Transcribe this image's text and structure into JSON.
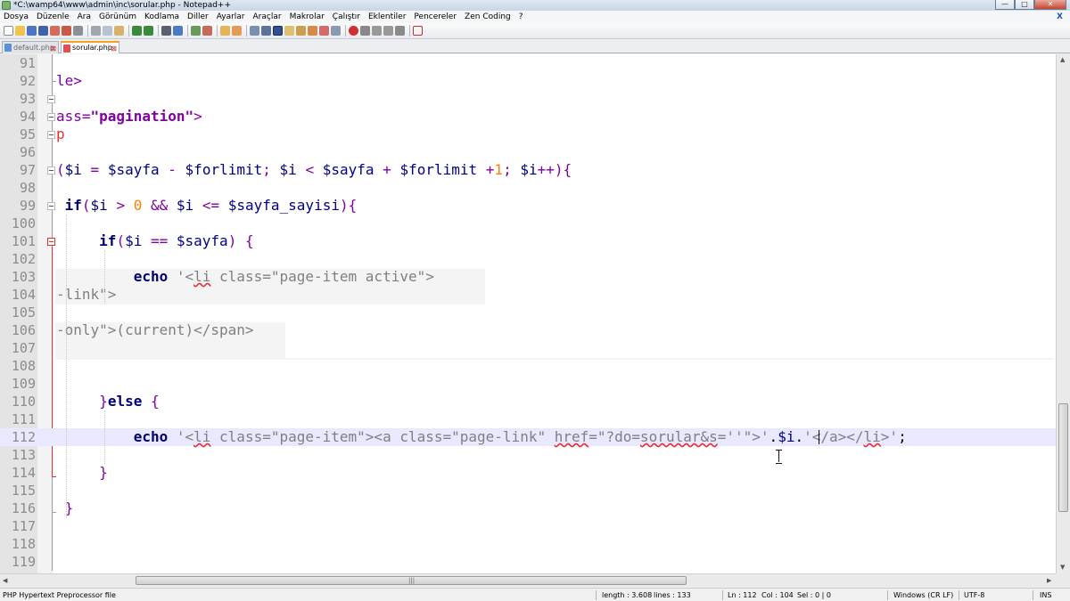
{
  "window": {
    "title": "*C:\\wamp64\\www\\admin\\inc\\sorular.php - Notepad++",
    "controls": {
      "minimize": "—",
      "maximize": "□",
      "close": "✕"
    }
  },
  "menu": {
    "items": [
      "Dosya",
      "Düzenle",
      "Ara",
      "Görünüm",
      "Kodlama",
      "Diller",
      "Ayarlar",
      "Araçlar",
      "Makrolar",
      "Çalıştır",
      "Eklentiler",
      "Pencereler",
      "Zen Coding",
      "?"
    ],
    "right_label": "X"
  },
  "tabs": [
    {
      "label": "default.php",
      "active": false,
      "icon_color": "#5b8fd6"
    },
    {
      "label": "sorular.php",
      "active": true,
      "icon_color": "#e05050"
    }
  ],
  "editor": {
    "lines": [
      91,
      92,
      93,
      94,
      95,
      96,
      97,
      98,
      99,
      100,
      101,
      102,
      103,
      104,
      105,
      106,
      107,
      108,
      109,
      110,
      111,
      112,
      113,
      114,
      115,
      116,
      117,
      118,
      119
    ],
    "current_line": 112
  },
  "status": {
    "file_type": "PHP Hypertext Preprocessor file",
    "length": "length : 3.608",
    "lines": "lines : 133",
    "ln": "Ln : 112",
    "col": "Col : 104",
    "sel": "Sel : 0 | 0",
    "eol": "Windows (CR LF)",
    "encoding": "UTF-8",
    "mode": "INS"
  },
  "colors": {
    "keyword": "#00006f",
    "string": "#808080",
    "operator": "#8000a0",
    "number": "#ff8000",
    "current_line_bg": "#e8e8ff",
    "active_tab_accent": "#f4a321"
  }
}
